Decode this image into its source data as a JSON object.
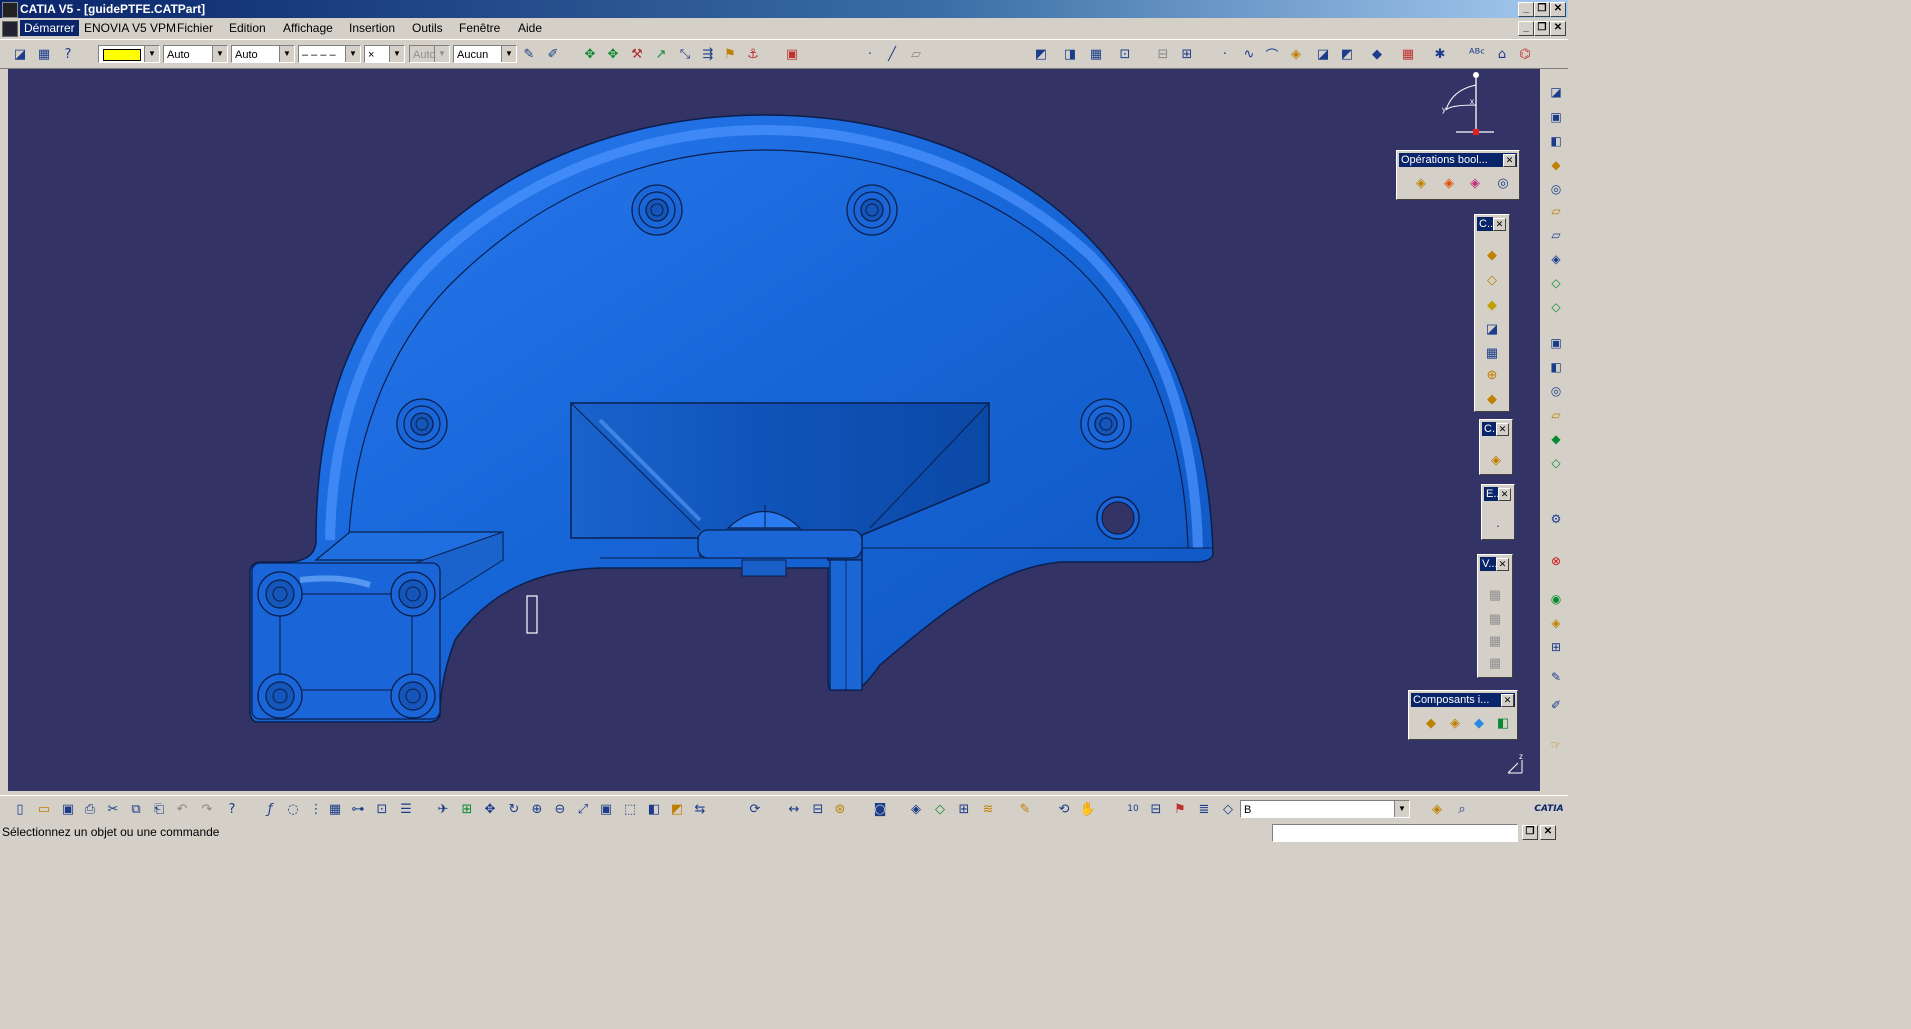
{
  "window": {
    "title": "CATIA V5 - [guidePTFE.CATPart]",
    "minimize": "_",
    "restore": "❐",
    "close": "✕"
  },
  "menu": {
    "items": [
      "Démarrer",
      "ENOVIA V5 VPM",
      "Fichier",
      "Edition",
      "Affichage",
      "Insertion",
      "Outils",
      "Fenêtre",
      "Aide"
    ]
  },
  "graphic_properties": {
    "color_swatch": "#ffff00",
    "transparency": "Auto",
    "line_thickness": "Auto",
    "line_type": "– – – –",
    "point_type": "×",
    "layer_disabled": "Auto",
    "layer": "Aucun"
  },
  "panels": {
    "boolean_ops": {
      "title": "Opérations bool...",
      "icons": [
        "assemble-icon",
        "add-icon",
        "remove-icon",
        "intersect-icon"
      ]
    },
    "c1": {
      "title": "C...",
      "icons": [
        "pad-icon",
        "pocket-icon",
        "shaft-icon",
        "groove-icon",
        "rib-icon",
        "hole-icon",
        "stiffener-icon"
      ]
    },
    "c2": {
      "title": "C...",
      "icons": [
        "surface-icon"
      ]
    },
    "e": {
      "title": "E...",
      "icons": [
        "point-icon"
      ]
    },
    "v": {
      "title": "V...",
      "icons": [
        "view-1-icon",
        "view-2-icon",
        "view-3-icon",
        "view-4-icon"
      ]
    },
    "composants": {
      "title": "Composants i...",
      "icons": [
        "component-1-icon",
        "component-2-icon",
        "component-3-icon",
        "component-4-icon"
      ]
    }
  },
  "bottom_toolbar": {
    "search_value": "B"
  },
  "status": {
    "message": "Sélectionnez un objet ou une commande"
  },
  "colors": {
    "viewport_bg": "#333366",
    "part_fill": "#1a66d9",
    "part_edge": "#0a1f4d",
    "titlebar": "#0a246a"
  }
}
